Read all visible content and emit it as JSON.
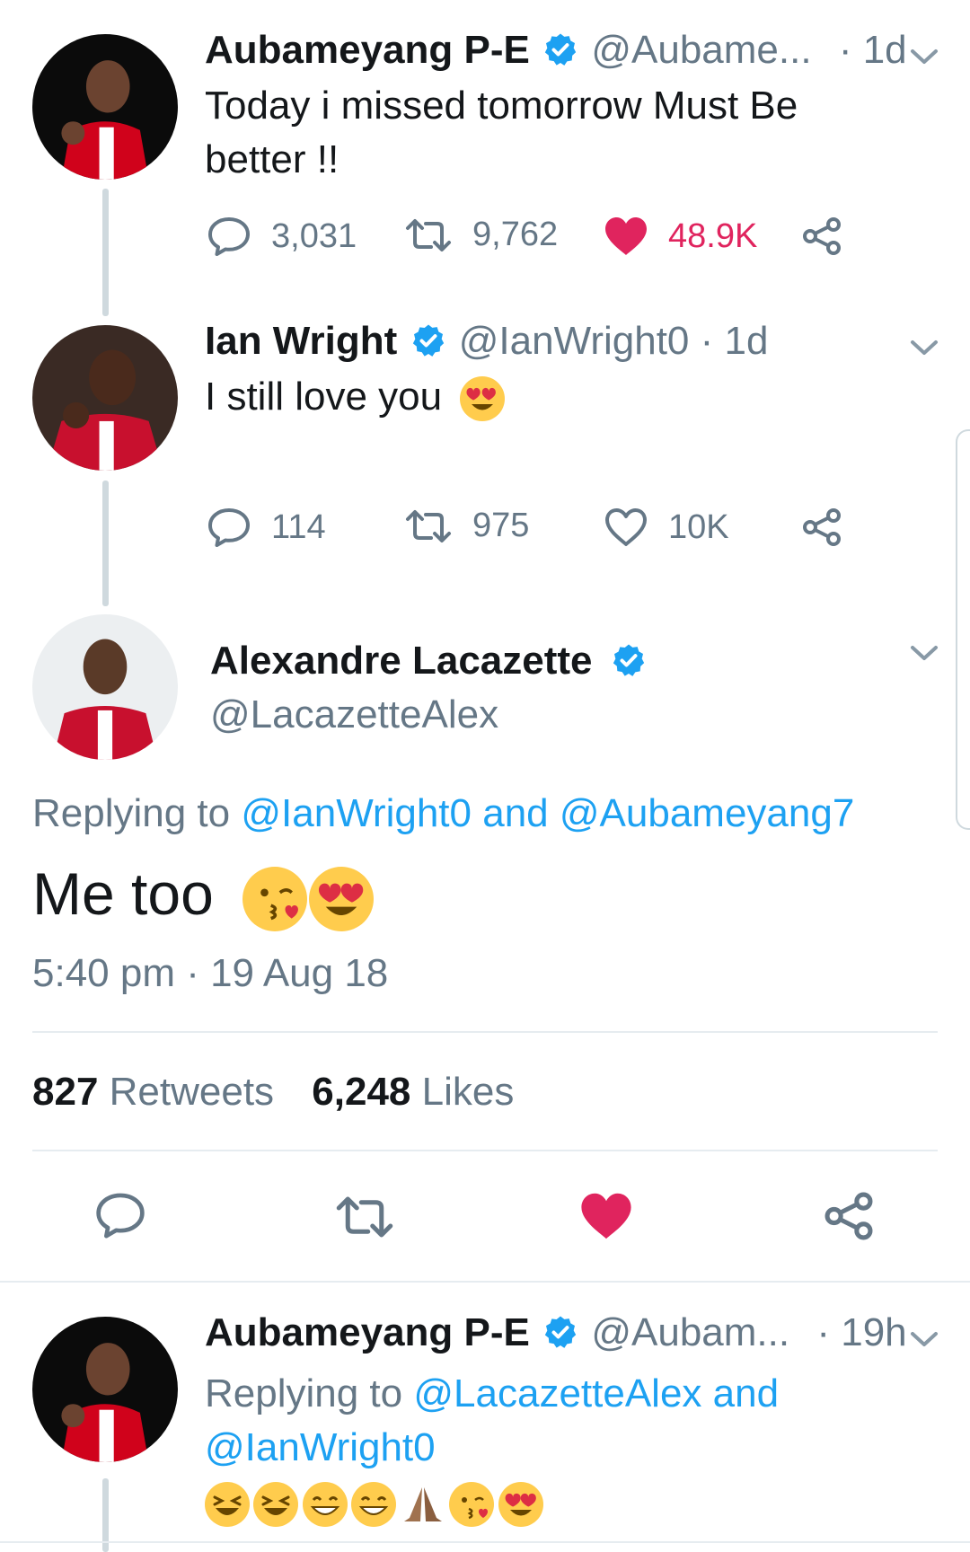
{
  "tweet1": {
    "name": "Aubameyang P-E",
    "handle": "@Aubame...",
    "time": "· 1d",
    "text_line1": "Today i missed tomorrow Must Be",
    "text_line2": "better !!",
    "replies": "3,031",
    "retweets": "9,762",
    "likes": "48.9K",
    "liked": true
  },
  "tweet2": {
    "name": "Ian Wright",
    "handle": "@IanWright0 · 1d",
    "text": "I still love you",
    "replies": "114",
    "retweets": "975",
    "likes": "10K",
    "liked": false
  },
  "main_tweet": {
    "name": "Alexandre Lacazette",
    "handle": "@LacazetteAlex",
    "replying_prefix": "Replying to ",
    "replying_to_1": "@IanWright0",
    "replying_and": " and ",
    "replying_to_2": "@Aubameyang7",
    "text": "Me too",
    "timestamp": "5:40 pm · 19 Aug 18",
    "retweet_count": "827",
    "retweet_label": " Retweets",
    "like_count": "6,248",
    "like_label": " Likes"
  },
  "tweet3": {
    "name": "Aubameyang P-E",
    "handle": "@Aubam...",
    "time": "· 19h",
    "replying_prefix": "Replying to ",
    "replying_to_1": "@LacazetteAlex",
    "replying_and": " and",
    "replying_to_2": "@IanWright0"
  },
  "colors": {
    "accent": "#1da1f2",
    "like": "#e0245e",
    "muted": "#657786",
    "verified": "#1da1f2"
  },
  "icons": [
    "reply-icon",
    "retweet-icon",
    "like-icon",
    "share-icon",
    "verified-badge-icon",
    "chevron-down-icon"
  ]
}
